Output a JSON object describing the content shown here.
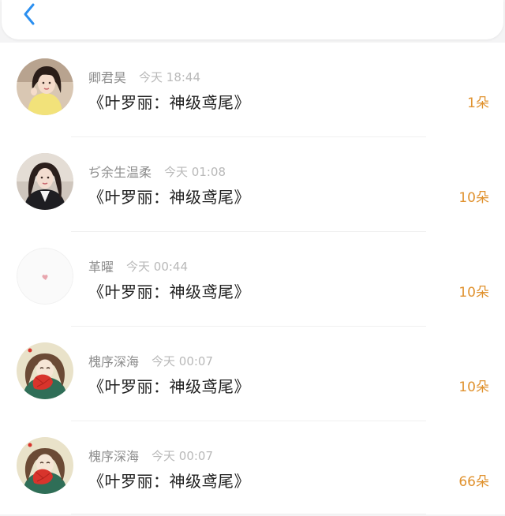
{
  "header": {
    "back_icon": "chevron-left-icon",
    "accent_color": "#2b8ff0"
  },
  "colors": {
    "count": "#e0922f",
    "username": "#8d8d8d",
    "time": "#b9b9b9",
    "title": "#1f1f1f"
  },
  "records": [
    {
      "username": "卿君昊",
      "time": "今天 18:44",
      "book": "《叶罗丽：神级鸢尾》",
      "count": "1朵",
      "avatar": "avatar-girl-yellow-dress"
    },
    {
      "username": "ぢ余生温柔",
      "time": "今天 01:08",
      "book": "《叶罗丽：神级鸢尾》",
      "count": "10朵",
      "avatar": "avatar-girl-dark-hair"
    },
    {
      "username": "革曜",
      "time": "今天 00:44",
      "book": "《叶罗丽：神级鸢尾》",
      "count": "10朵",
      "avatar": "avatar-pink-heart"
    },
    {
      "username": "槐序深海",
      "time": "今天 00:07",
      "book": "《叶罗丽：神级鸢尾》",
      "count": "10朵",
      "avatar": "avatar-girl-red-fan"
    },
    {
      "username": "槐序深海",
      "time": "今天 00:07",
      "book": "《叶罗丽：神级鸢尾》",
      "count": "66朵",
      "avatar": "avatar-girl-red-fan"
    }
  ]
}
